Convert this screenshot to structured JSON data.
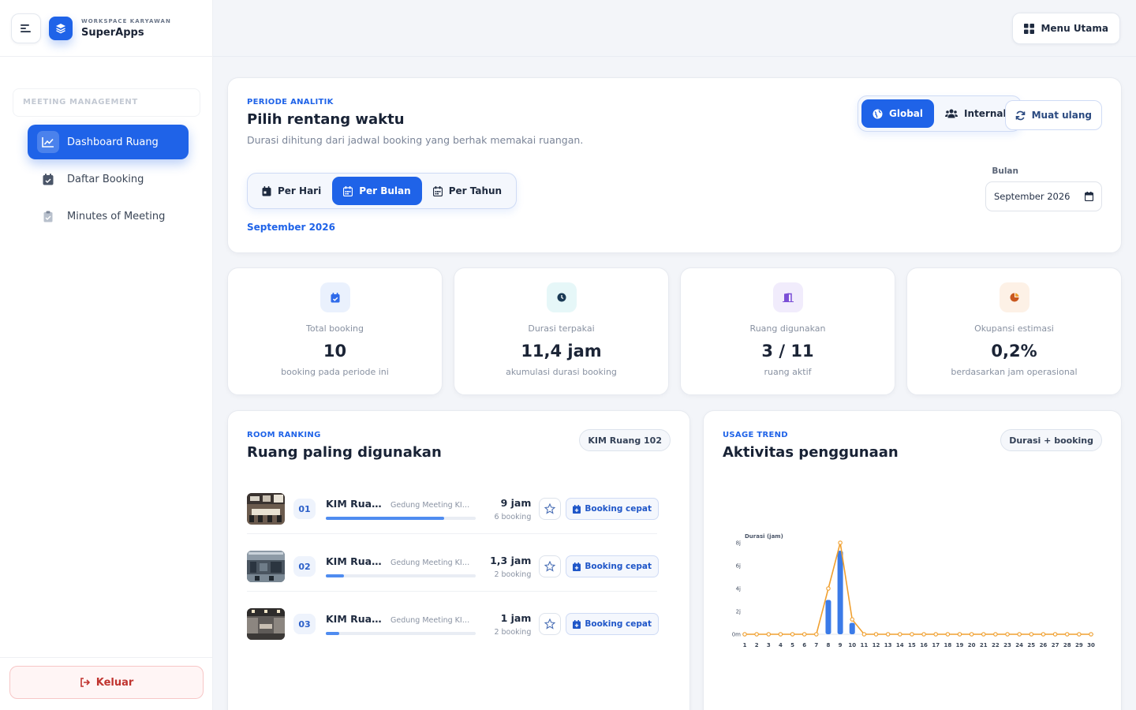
{
  "brand": {
    "subtitle": "WORKSPACE KARYAWAN",
    "name": "SuperApps"
  },
  "sidebar": {
    "section_label": "MEETING MANAGEMENT",
    "items": [
      {
        "label": "Dashboard Ruang",
        "icon": "chart-line-icon",
        "active": true
      },
      {
        "label": "Daftar Booking",
        "icon": "calendar-check-icon",
        "active": false
      },
      {
        "label": "Minutes of Meeting",
        "icon": "clipboard-icon",
        "active": false
      }
    ],
    "logout_label": "Keluar"
  },
  "topbar": {
    "menu_label": "Menu Utama"
  },
  "period": {
    "eyebrow": "PERIODE ANALITIK",
    "title": "Pilih rentang waktu",
    "description": "Durasi dihitung dari jadwal booking yang berhak memakai ruangan.",
    "scope_tabs": [
      {
        "label": "Global",
        "active": true
      },
      {
        "label": "Internal",
        "active": false
      }
    ],
    "reload_label": "Muat ulang",
    "granularity_tabs": [
      {
        "label": "Per Hari",
        "active": false
      },
      {
        "label": "Per Bulan",
        "active": true
      },
      {
        "label": "Per Tahun",
        "active": false
      }
    ],
    "selected_label": "September 2026",
    "month_field_label": "Bulan",
    "month_value": "September 2026"
  },
  "stats": [
    {
      "label": "Total booking",
      "value": "10",
      "sub": "booking pada periode ini",
      "icon": "calendar-check-icon",
      "color": "#2f6bea",
      "bg": "#eaf1fd"
    },
    {
      "label": "Durasi terpakai",
      "value": "11,4 jam",
      "sub": "akumulasi durasi booking",
      "icon": "clock-icon",
      "color": "#0e7f8c",
      "bg": "#e6f7f8"
    },
    {
      "label": "Ruang digunakan",
      "value": "3 / 11",
      "sub": "ruang aktif",
      "icon": "door-icon",
      "color": "#7b4fd6",
      "bg": "#f1ecfc"
    },
    {
      "label": "Okupansi estimasi",
      "value": "0,2%",
      "sub": "berdasarkan jam operasional",
      "icon": "pie-chart-icon",
      "color": "#d9772b",
      "bg": "#fdf1e6"
    }
  ],
  "ranking": {
    "eyebrow": "ROOM RANKING",
    "title": "Ruang paling digunakan",
    "badge": "KIM Ruang 102",
    "quick_label": "Booking cepat",
    "rows": [
      {
        "rank": "01",
        "name": "KIM Ruan...",
        "building": "Gedung Meeting KIM -...",
        "hours": "9 jam",
        "count": "6 booking",
        "share": 0.79
      },
      {
        "rank": "02",
        "name": "KIM Ruan...",
        "building": "Gedung Meeting KIM -...",
        "hours": "1,3 jam",
        "count": "2 booking",
        "share": 0.12
      },
      {
        "rank": "03",
        "name": "KIM Ruan...",
        "building": "Gedung Meeting KIM -...",
        "hours": "1 jam",
        "count": "2 booking",
        "share": 0.09
      }
    ]
  },
  "trend": {
    "eyebrow": "USAGE TREND",
    "title": "Aktivitas penggunaan",
    "badge": "Durasi + booking"
  },
  "chart_data": {
    "type": "bar",
    "ylabel": "Durasi (jam)",
    "ylim": [
      0,
      8
    ],
    "y_ticks": [
      "0m",
      "2j",
      "4j",
      "6j",
      "8j"
    ],
    "categories": [
      "1",
      "2",
      "3",
      "4",
      "5",
      "6",
      "7",
      "8",
      "9",
      "10",
      "11",
      "12",
      "13",
      "14",
      "15",
      "16",
      "17",
      "18",
      "19",
      "20",
      "21",
      "22",
      "23",
      "24",
      "25",
      "26",
      "27",
      "28",
      "29",
      "30"
    ],
    "series": [
      {
        "kind": "bar",
        "color": "#3b7be8",
        "values": [
          0,
          0,
          0,
          0,
          0,
          0,
          0,
          3,
          7.3,
          1,
          0,
          0,
          0,
          0,
          0,
          0,
          0,
          0,
          0,
          0,
          0,
          0,
          0,
          0,
          0,
          0,
          0,
          0,
          0,
          0
        ]
      },
      {
        "kind": "line",
        "color": "#f0a030",
        "values": [
          0,
          0,
          0,
          0,
          0,
          0,
          0,
          4,
          8,
          1.3,
          0,
          0,
          0,
          0,
          0,
          0,
          0,
          0,
          0,
          0,
          0,
          0,
          0,
          0,
          0,
          0,
          0,
          0,
          0,
          0
        ]
      }
    ],
    "grid": false,
    "legend": "none"
  }
}
